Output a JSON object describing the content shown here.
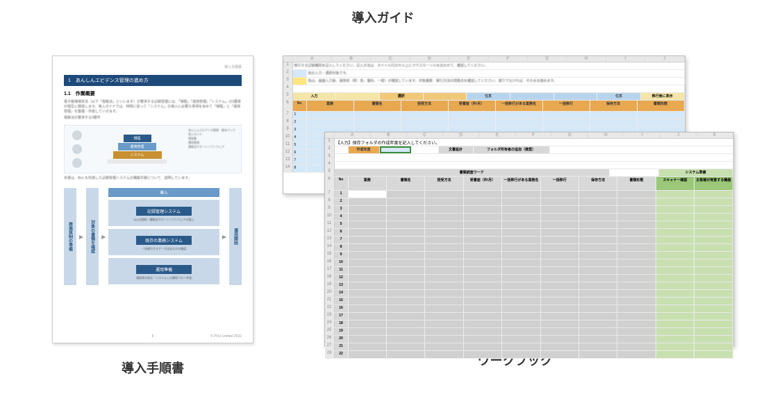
{
  "page_title": "導入ガイド",
  "captions": {
    "left": "導入手順書",
    "right": "ワークブック"
  },
  "document": {
    "topright_label": "導入手順書",
    "chapter_bar": "1　あんしんエビデンス管理の進め方",
    "section_num": "1.1　作業概要",
    "para1": "電子帳簿保存法（以下「電帳法」といいます）が要求する記録管理には、「規程」「運用管理」「システム」の3要素が相互に関係します。導入ガイドでは、特例に従って「システム」の導入に必要な事項を含めて「規程」と「運用管理」を整理・作成していきます。",
    "para_sub": "電帳法が要求する3要件",
    "pyramid": {
      "top": "規程",
      "mid": "運用管理",
      "sys": "システム",
      "base": "電帳法サポートソフトウェア"
    },
    "pyramid_right_title": "あんしんエビデンス管理　基本パック",
    "pyramid_right_items": [
      "導入ガイド",
      "規程集",
      "運用管理",
      "電帳法サポートソフトウェア"
    ],
    "para2": "本書は、Box を利用した記録管理システムの構築手順について、説明しています。",
    "flow": {
      "left_bar": "推進体制の準備",
      "mid_bar": "対象の書類を確認",
      "right_bar": "運用開始",
      "top_header": "導入",
      "block1_title": "記録管理システム",
      "block1_sub": "Boxの契約／電帳法サポートソフトウェアの導入",
      "block2_title": "既存の業務システム",
      "block2_sub": "一括移行するデータはあるかの確認",
      "block3_title": "運用準備",
      "block3_sub": "規程等の修正／システム上の運用フロー作成"
    },
    "footer": "© PFU Limited 2022",
    "page_no": "6"
  },
  "workbook_back": {
    "note1": "移行する記録種別を記入してください。記入方法は、タイトル行のセル上にマウスカーソルを合わせて、確認してください。",
    "note2": "色の入力・選択対象です。",
    "note3": "色は、画面入力後、運用状（例：色、優先、一部）が確認しています。対象業務　実行方法の問題点を確認してください。誤りでなければ、そのまま進めます。",
    "hdr_row1": [
      "入力",
      "",
      "選択",
      "",
      "任意",
      "",
      "",
      "任意",
      "移行後に表示"
    ],
    "hdr_row2": [
      "No",
      "業務",
      "書類名",
      "授受方法",
      "受書面（件/月）",
      "一括移行がある業務名",
      "一括移行",
      "保存方法",
      "書類形態"
    ]
  },
  "workbook_front": {
    "instruction": "【入力】保存フォルダの作成年度を記入してください。",
    "input_label": "作成年度",
    "btn1": "文書設計",
    "btn2": "フォルダ所有者の追加（推奨）",
    "group_left": "書類調査ワーク",
    "group_right": "システム準備",
    "headers": [
      "No",
      "業務",
      "書類名",
      "授受方法",
      "受書面（件/月）",
      "一括移行がある業務名",
      "一括移行",
      "保存方法",
      "書類形態",
      "スキャナー確認",
      "お客様が用意する機器"
    ],
    "col_letters": [
      "A",
      "B",
      "C",
      "D",
      "E",
      "F",
      "G",
      "H",
      "I",
      "J",
      "K"
    ],
    "rows_shown": 25
  },
  "colors": {
    "doc_blue_dark": "#1e4a7a",
    "doc_blue_mid": "#6a9ac8",
    "doc_orange": "#c89030",
    "xl_yellow": "#ffe680",
    "xl_blue": "#d4e8f8",
    "xl_green": "#9ac878",
    "xl_orange": "#f0c878"
  }
}
